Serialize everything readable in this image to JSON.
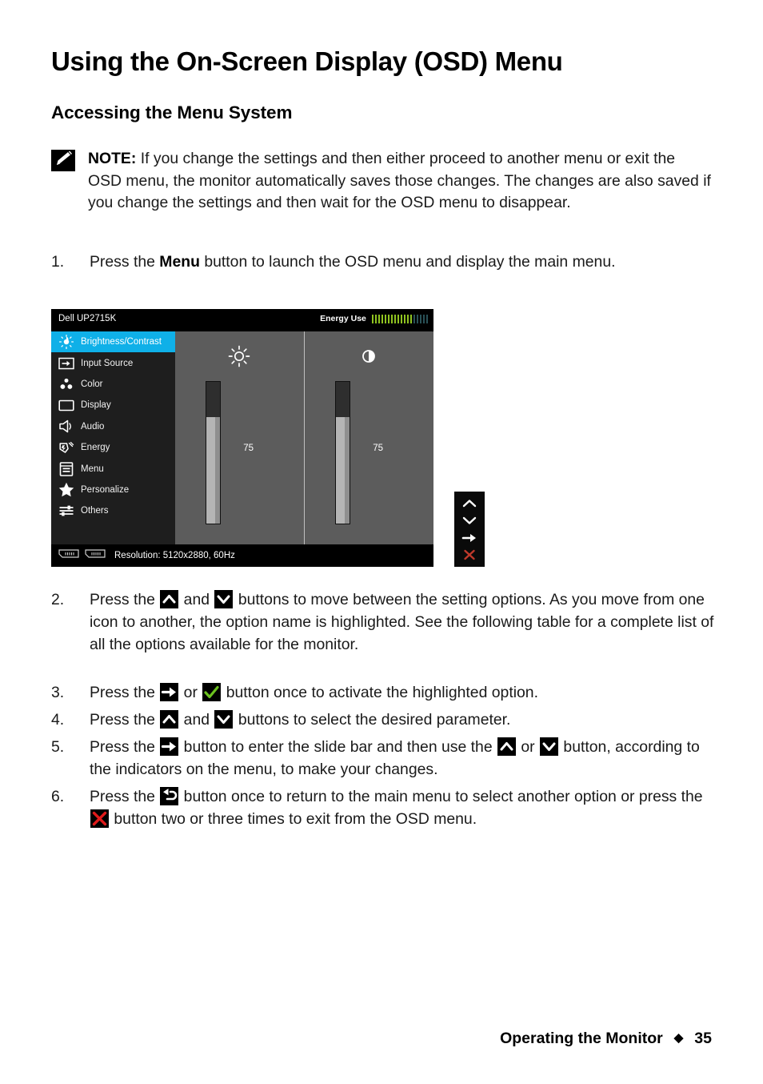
{
  "page": {
    "title": "Using the On-Screen Display (OSD) Menu",
    "subtitle": "Accessing the Menu System"
  },
  "note": {
    "icon": "pencil-note-icon",
    "label": "NOTE:",
    "text": " If you change the settings and then either proceed to another menu or exit the OSD menu, the monitor automatically saves those changes. The changes are also saved if you change the settings and then wait for the OSD menu to disappear."
  },
  "steps": [
    {
      "number": "1.",
      "parts": [
        {
          "type": "text",
          "value": "Press the "
        },
        {
          "type": "bold",
          "value": "Menu"
        },
        {
          "type": "text",
          "value": " button to launch the OSD menu and display the main menu."
        }
      ]
    },
    {
      "number": "2.",
      "parts": [
        {
          "type": "text",
          "value": "Press the "
        },
        {
          "type": "icon",
          "value": "up-chevron-icon"
        },
        {
          "type": "text",
          "value": " and "
        },
        {
          "type": "icon",
          "value": "down-chevron-icon"
        },
        {
          "type": "text",
          "value": " buttons to move between the setting options. As you move from one icon to another, the option name is highlighted. See the following table for a complete list of all the options available for the monitor."
        }
      ]
    },
    {
      "number": "3.",
      "parts": [
        {
          "type": "text",
          "value": "Press the "
        },
        {
          "type": "icon",
          "value": "right-arrow-icon"
        },
        {
          "type": "text",
          "value": " or "
        },
        {
          "type": "icon",
          "value": "check-icon"
        },
        {
          "type": "text",
          "value": " button once to activate the highlighted option."
        }
      ]
    },
    {
      "number": "4.",
      "parts": [
        {
          "type": "text",
          "value": "Press the "
        },
        {
          "type": "icon",
          "value": "up-chevron-icon"
        },
        {
          "type": "text",
          "value": " and "
        },
        {
          "type": "icon",
          "value": "down-chevron-icon"
        },
        {
          "type": "text",
          "value": " buttons to select the desired parameter."
        }
      ]
    },
    {
      "number": "5.",
      "parts": [
        {
          "type": "text",
          "value": "Press the "
        },
        {
          "type": "icon",
          "value": "right-arrow-icon"
        },
        {
          "type": "text",
          "value": " button to enter the slide bar and then use the "
        },
        {
          "type": "icon",
          "value": "up-chevron-icon"
        },
        {
          "type": "text",
          "value": " or "
        },
        {
          "type": "icon",
          "value": "down-chevron-icon"
        },
        {
          "type": "text",
          "value": " button, according to the indicators on the menu, to make your changes."
        }
      ]
    },
    {
      "number": "6.",
      "parts": [
        {
          "type": "text",
          "value": "Press the "
        },
        {
          "type": "icon",
          "value": "back-arrow-icon"
        },
        {
          "type": "text",
          "value": " button once to return to the main menu to select another option or press the "
        },
        {
          "type": "icon",
          "value": "close-x-icon"
        },
        {
          "type": "text",
          "value": " button two or three times to exit from the OSD menu."
        }
      ]
    }
  ],
  "osd": {
    "model": "Dell UP2715K",
    "energy": {
      "label": "Energy Use",
      "total_segments": 18,
      "lit_segments": 13,
      "lit_color": "#8fc320",
      "dim_color": "#2a5157"
    },
    "menu_items": [
      {
        "label": "Brightness/Contrast",
        "icon": "brightness-icon",
        "active": true
      },
      {
        "label": "Input Source",
        "icon": "input-source-icon",
        "active": false
      },
      {
        "label": "Color",
        "icon": "color-icon",
        "active": false
      },
      {
        "label": "Display",
        "icon": "display-icon",
        "active": false
      },
      {
        "label": "Audio",
        "icon": "audio-speaker-icon",
        "active": false
      },
      {
        "label": "Energy",
        "icon": "energy-icon",
        "active": false
      },
      {
        "label": "Menu",
        "icon": "menu-icon",
        "active": false
      },
      {
        "label": "Personalize",
        "icon": "star-icon",
        "active": false
      },
      {
        "label": "Others",
        "icon": "others-sliders-icon",
        "active": false
      }
    ],
    "panes": [
      {
        "icon": "sun-brightness-icon",
        "value": "75",
        "fill_percent": 75
      },
      {
        "icon": "contrast-circle-icon",
        "value": "75",
        "fill_percent": 75
      }
    ],
    "status": {
      "port_icon_1": "display-port-icon",
      "port_icon_2": "display-port-icon",
      "resolution_text": "Resolution: 5120x2880, 60Hz"
    },
    "nav_buttons": [
      {
        "icon": "up-chevron-icon",
        "color": "#ffffff"
      },
      {
        "icon": "down-chevron-icon",
        "color": "#ffffff"
      },
      {
        "icon": "right-arrow-icon",
        "color": "#ffffff"
      },
      {
        "icon": "close-x-icon",
        "color": "#c0392b"
      }
    ],
    "highlight_color": "#0fb0e8"
  },
  "footer": {
    "section": "Operating the Monitor",
    "separator": "◆",
    "page_number": "35"
  }
}
